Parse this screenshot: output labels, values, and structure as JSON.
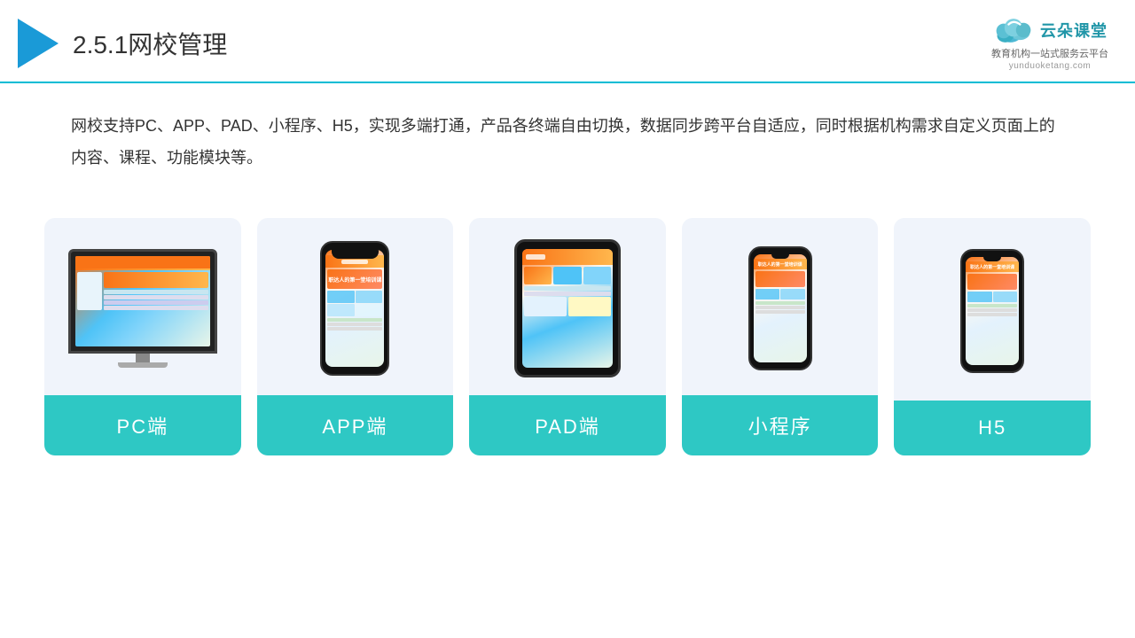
{
  "header": {
    "title_number": "2.5.1",
    "title_text": "网校管理",
    "logo_main": "云朵课堂",
    "logo_url": "yunduoketang.com",
    "logo_tagline": "教育机构一站\n式服务云平台"
  },
  "description": {
    "text": "网校支持PC、APP、PAD、小程序、H5，实现多端打通，产品各终端自由切换，数据同步跨平台自适应，同时根据机构需求自定义页面上的内容、课程、功能模块等。"
  },
  "cards": [
    {
      "id": "pc",
      "label": "PC端"
    },
    {
      "id": "app",
      "label": "APP端"
    },
    {
      "id": "pad",
      "label": "PAD端"
    },
    {
      "id": "miniprogram",
      "label": "小程序"
    },
    {
      "id": "h5",
      "label": "H5"
    }
  ],
  "colors": {
    "accent": "#2ec8c4",
    "border_bottom": "#00bcd4",
    "header_bg": "#fff",
    "card_bg": "#eef2f9"
  }
}
